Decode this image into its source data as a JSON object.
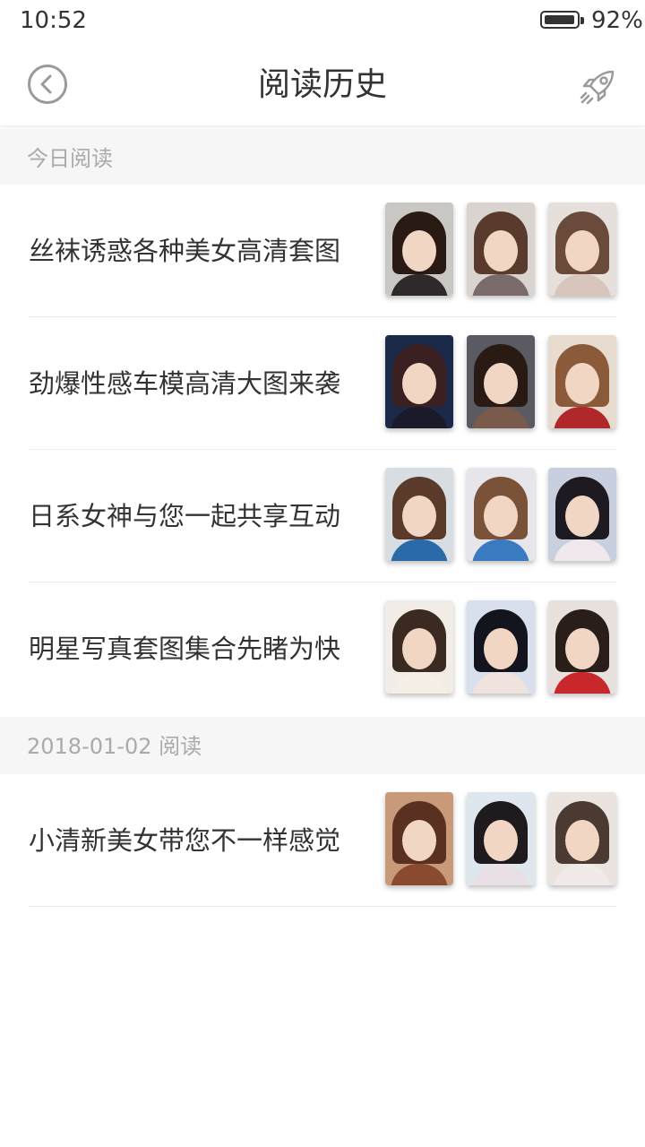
{
  "status_bar": {
    "time": "10:52",
    "battery_percent": "92%",
    "battery_level": 0.92
  },
  "header": {
    "title": "阅读历史",
    "back_icon": "back-circle-icon",
    "right_icon": "rocket-icon"
  },
  "sections": [
    {
      "label": "今日阅读"
    },
    {
      "label": "2018-01-02 阅读"
    }
  ],
  "items": [
    {
      "title": "丝袜诱惑各种美女高清套图",
      "thumbs": [
        {
          "bg": "#c9c7c4",
          "hair": "#2a1a14",
          "shoulder": "#2e2a2a"
        },
        {
          "bg": "#d9d4d0",
          "hair": "#5a3a2c",
          "shoulder": "#7a6a6a"
        },
        {
          "bg": "#e5e0dc",
          "hair": "#6a4a3a",
          "shoulder": "#d8c6bc"
        }
      ]
    },
    {
      "title": "劲爆性感车模高清大图来袭",
      "thumbs": [
        {
          "bg": "#1c2a4a",
          "hair": "#3a2020",
          "shoulder": "#1a1a2a"
        },
        {
          "bg": "#5a5a62",
          "hair": "#2a1a14",
          "shoulder": "#7a5a4a"
        },
        {
          "bg": "#e8dcd0",
          "hair": "#8a5a3a",
          "shoulder": "#b0282a"
        }
      ]
    },
    {
      "title": "日系女神与您一起共享互动",
      "thumbs": [
        {
          "bg": "#d8dde2",
          "hair": "#5a3a2a",
          "shoulder": "#2a6aa8"
        },
        {
          "bg": "#e6e6ea",
          "hair": "#7a5238",
          "shoulder": "#3a7ac0"
        },
        {
          "bg": "#c8d0e0",
          "hair": "#1e1a22",
          "shoulder": "#f0e8ec"
        }
      ]
    },
    {
      "title": "明星写真套图集合先睹为快",
      "thumbs": [
        {
          "bg": "#f2ece6",
          "hair": "#3a2a22",
          "shoulder": "#f5efe6"
        },
        {
          "bg": "#d8e0ee",
          "hair": "#14141e",
          "shoulder": "#f0e2dc"
        },
        {
          "bg": "#e8e0dc",
          "hair": "#2a1e1a",
          "shoulder": "#c8282a"
        }
      ]
    },
    {
      "title": "小清新美女带您不一样感觉",
      "thumbs": [
        {
          "bg": "#c89a7a",
          "hair": "#5a3020",
          "shoulder": "#8a4a30"
        },
        {
          "bg": "#dfe7ee",
          "hair": "#1e1a1e",
          "shoulder": "#e8e0e6"
        },
        {
          "bg": "#eae4e0",
          "hair": "#4a3a32",
          "shoulder": "#f0ebe8"
        }
      ]
    }
  ]
}
